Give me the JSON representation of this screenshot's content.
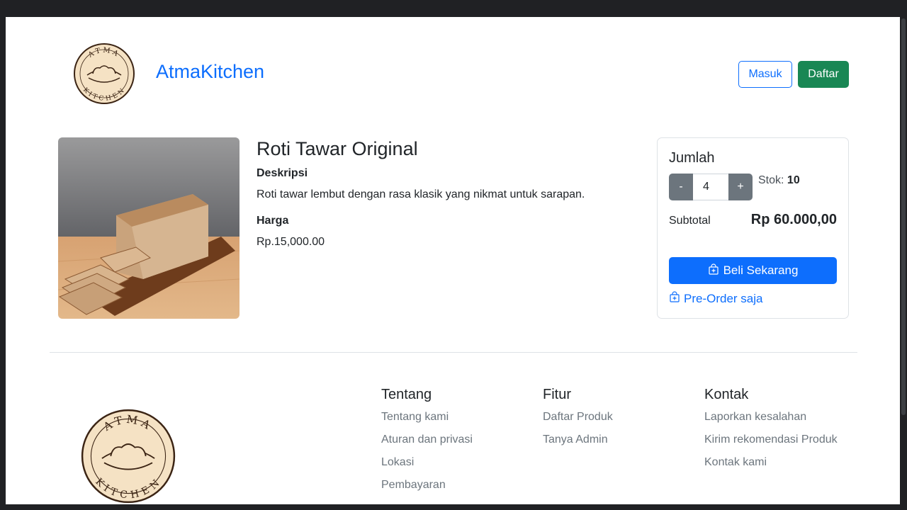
{
  "header": {
    "brand": "AtmaKitchen",
    "logo_text_top": "ATMA",
    "logo_text_bottom": "KITCHEN",
    "login_label": "Masuk",
    "register_label": "Daftar"
  },
  "product": {
    "title": "Roti Tawar Original",
    "description_label": "Deskripsi",
    "description": "Roti tawar lembut dengan rasa klasik yang nikmat untuk sarapan.",
    "price_label": "Harga",
    "price": "Rp.15,000.00"
  },
  "order": {
    "quantity_label": "Jumlah",
    "minus_label": "-",
    "plus_label": "+",
    "quantity": "4",
    "stock_label": "Stok:",
    "stock_value": "10",
    "subtotal_label": "Subtotal",
    "subtotal_value": "Rp 60.000,00",
    "buy_label": "Beli Sekarang",
    "preorder_label": "Pre-Order saja"
  },
  "footer": {
    "columns": [
      {
        "title": "Tentang",
        "links": [
          "Tentang kami",
          "Aturan dan privasi",
          "Lokasi",
          "Pembayaran"
        ]
      },
      {
        "title": "Fitur",
        "links": [
          "Daftar Produk",
          "Tanya Admin"
        ]
      },
      {
        "title": "Kontak",
        "links": [
          "Laporkan kesalahan",
          "Kirim rekomendasi Produk",
          "Kontak kami"
        ]
      }
    ]
  },
  "colors": {
    "primary": "#0d6efd",
    "success": "#198754",
    "secondary": "#6c757d",
    "logo_fill": "#f5e2c4",
    "logo_ink": "#3b2414"
  },
  "icons": {
    "buy": "bag-plus-icon",
    "preorder": "bag-plus-icon"
  }
}
